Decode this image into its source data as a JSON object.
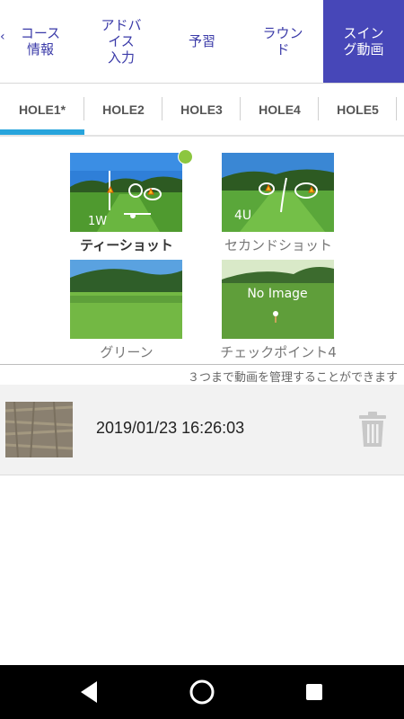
{
  "top_tabs": [
    {
      "label": "コース\n情報",
      "active": false
    },
    {
      "label": "アドバ\nイス\n入力",
      "active": false
    },
    {
      "label": "予習",
      "active": false
    },
    {
      "label": "ラウン\nド",
      "active": false
    },
    {
      "label": "スイン\nグ動画",
      "active": true
    }
  ],
  "hole_tabs": [
    {
      "label": "HOLE1*",
      "active": true
    },
    {
      "label": "HOLE2",
      "active": false
    },
    {
      "label": "HOLE3",
      "active": false
    },
    {
      "label": "HOLE4",
      "active": false
    },
    {
      "label": "HOLE5",
      "active": false
    }
  ],
  "shots": [
    {
      "label": "ティーショット",
      "selected": true,
      "overlay_text": "1W"
    },
    {
      "label": "セカンドショット",
      "selected": false,
      "overlay_text": "4U"
    },
    {
      "label": "グリーン",
      "selected": false
    },
    {
      "label": "チェックポイント4",
      "selected": false,
      "overlay_text": "No Image"
    }
  ],
  "note": "３つまで動画を管理することができます",
  "videos": [
    {
      "datetime": "2019/01/23 16:26:03"
    }
  ],
  "colors": {
    "active_tab_bg": "#4747b8",
    "tab_text": "#3a3aa8",
    "hole_indicator": "#27a4dc",
    "status_dot": "#8cc63f"
  },
  "icons": {
    "trash": "trash-icon",
    "back": "back-icon",
    "home": "home-icon",
    "recents": "recents-icon"
  }
}
